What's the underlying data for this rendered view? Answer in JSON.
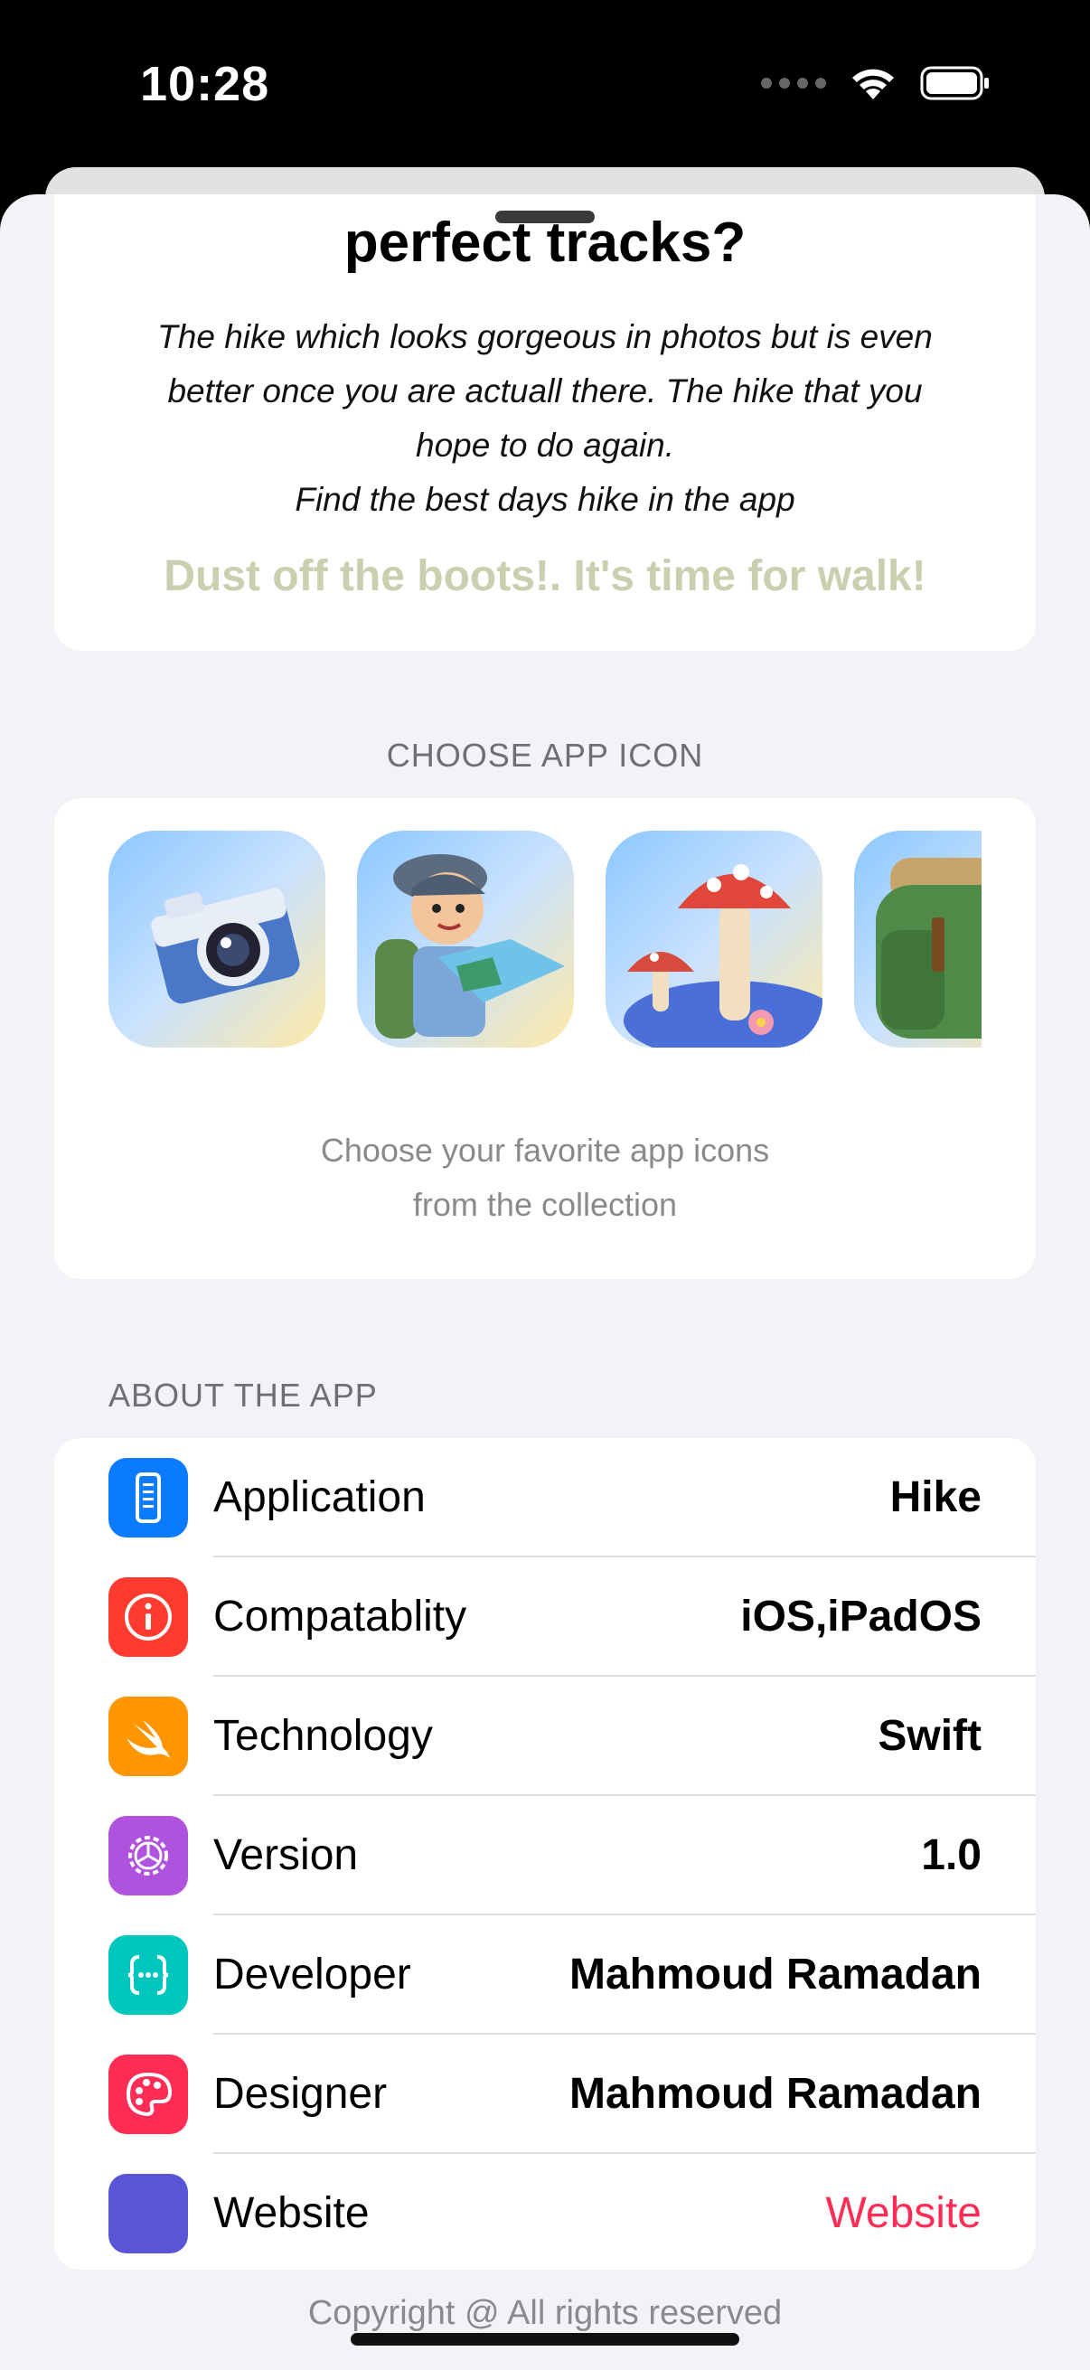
{
  "status_bar": {
    "time": "10:28"
  },
  "hero": {
    "title": "perfect tracks?",
    "description_lines": [
      "The hike which looks gorgeous in photos but is even",
      "better once you are actuall there. The hike that you",
      "hope to do again.",
      "Find the best days hike in the app"
    ],
    "tagline": "Dust off the boots!. It's time for walk!"
  },
  "app_icon_section": {
    "header": "CHOOSE APP ICON",
    "caption_lines": [
      "Choose your favorite app icons",
      "from the collection"
    ],
    "icons": [
      "camera-app-icon",
      "hiker-boy-app-icon",
      "mushroom-app-icon",
      "backpack-app-icon"
    ]
  },
  "about_section": {
    "header": "ABOUT THE APP",
    "rows": [
      {
        "label": "Application",
        "value": "Hike",
        "icon": "device-icon",
        "color": "#0a7aff"
      },
      {
        "label": "Compatablity",
        "value": "iOS,iPadOS",
        "icon": "info-icon",
        "color": "#ff3b30"
      },
      {
        "label": "Technology",
        "value": "Swift",
        "icon": "swift-icon",
        "color": "#ff9500"
      },
      {
        "label": "Version",
        "value": "1.0",
        "icon": "gear-icon",
        "color": "#af52de"
      },
      {
        "label": "Developer",
        "value": "Mahmoud Ramadan",
        "icon": "curly-braces-icon",
        "color": "#00c7be"
      },
      {
        "label": "Designer",
        "value": "Mahmoud Ramadan",
        "icon": "palette-icon",
        "color": "#ff2d55"
      },
      {
        "label": "Website",
        "value": "Website",
        "icon": "globe-icon",
        "color": "#5856d6"
      }
    ]
  },
  "footer": {
    "copyright": "Copyright @ All rights reserved"
  }
}
